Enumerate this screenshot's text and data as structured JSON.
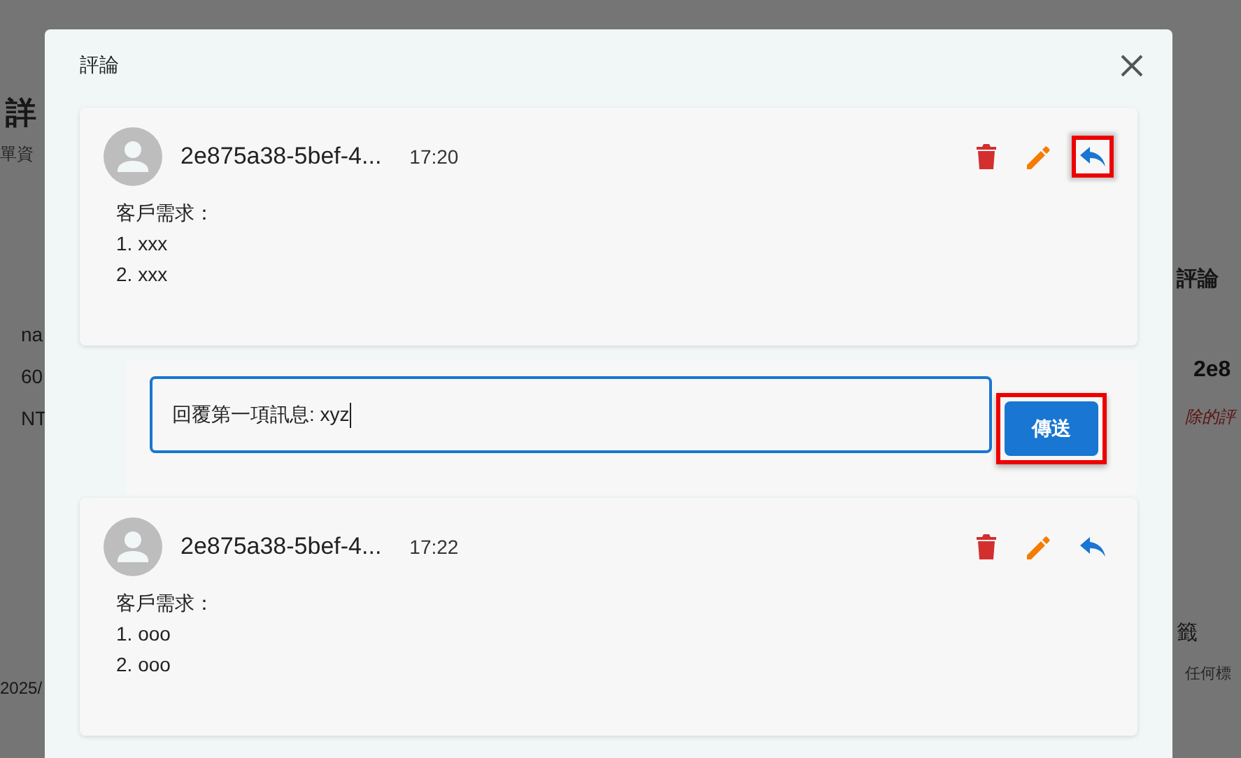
{
  "background": {
    "left": [
      {
        "kind": "heading",
        "text": "詳"
      },
      {
        "kind": "subtitle",
        "text": "單資"
      },
      {
        "kind": "field",
        "text": "na"
      },
      {
        "kind": "field",
        "text": "60"
      },
      {
        "kind": "field",
        "text": "NT"
      },
      {
        "kind": "date",
        "text": "2025/"
      }
    ],
    "right": [
      {
        "kind": "heading",
        "text": "評論"
      },
      {
        "kind": "author",
        "text": "2e8"
      },
      {
        "kind": "deleted",
        "text": "除的評"
      },
      {
        "kind": "label",
        "text": "籤"
      },
      {
        "kind": "note",
        "text": "任何標"
      }
    ]
  },
  "dialog": {
    "title": "評論",
    "items": [
      {
        "kind": "comment",
        "author": "2e875a38-5bef-4...",
        "time": "17:20",
        "lines": [
          "客戶需求：",
          "1. xxx",
          "2. xxx"
        ],
        "reply_highlighted": true
      },
      {
        "kind": "reply",
        "value": "回覆第一項訊息: xyz",
        "button": "傳送",
        "button_highlighted": true
      },
      {
        "kind": "comment",
        "author": "2e875a38-5bef-4...",
        "time": "17:22",
        "lines": [
          "客戶需求：",
          "1. ooo",
          "2. ooo"
        ],
        "reply_highlighted": false
      }
    ]
  }
}
